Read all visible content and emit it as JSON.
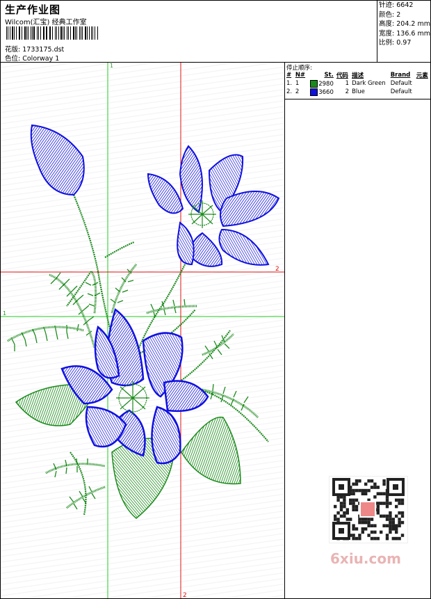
{
  "header": {
    "title": "生产作业图",
    "studio": "Wilcom(汇宝) 经典工作室",
    "file_label": "花版:",
    "file_name": "1733175.dst",
    "colorway_label": "色位:",
    "colorway_name": "Colorway 1"
  },
  "stats": [
    {
      "label": "针迹:",
      "value": "6642"
    },
    {
      "label": "颜色:",
      "value": "2"
    },
    {
      "label": "高度:",
      "value": "204.2 mm"
    },
    {
      "label": "宽度:",
      "value": "136.6 mm"
    },
    {
      "label": "比例:",
      "value": "0.97"
    }
  ],
  "stop_panel": {
    "title": "停止顺序:",
    "headers": [
      "#",
      "N#",
      "St.",
      "代码",
      "描述",
      "Brand",
      "元素"
    ],
    "rows": [
      {
        "index": "1.",
        "n": "1",
        "color": "#1a8a1a",
        "stitches": "2980",
        "code": "1",
        "desc": "Dark Green",
        "brand": "Default"
      },
      {
        "index": "2.",
        "n": "2",
        "color": "#1010e0",
        "stitches": "3660",
        "code": "2",
        "desc": "Blue",
        "brand": "Default"
      }
    ]
  },
  "guides": {
    "v1_label": "1",
    "h1_label": "1",
    "h2_label": "2",
    "v2_label": "2"
  },
  "colors": {
    "green_thread": "#1a8a1a",
    "blue_thread": "#1010e0",
    "guide_green": "#22cc22",
    "guide_red": "#dd1111"
  },
  "watermark": "6xiu.com"
}
